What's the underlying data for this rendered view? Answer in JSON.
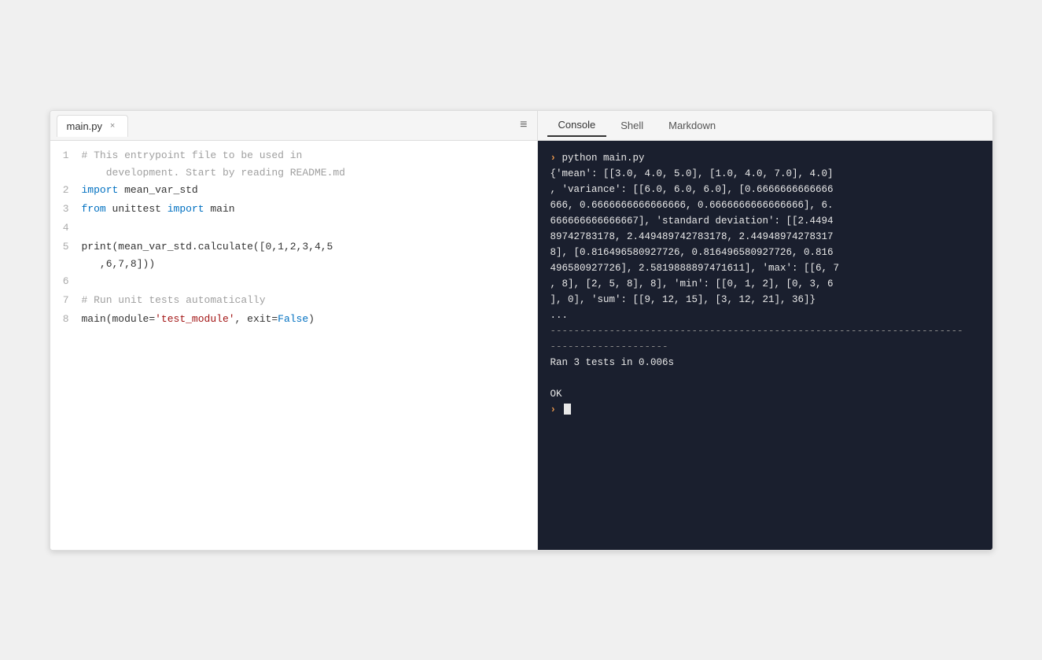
{
  "editor": {
    "tab": {
      "label": "main.py",
      "close": "×"
    },
    "menu_icon": "≡",
    "lines": [
      {
        "number": "1",
        "tokens": [
          {
            "text": "  # This entrypoint file to be used in\n    development. Start by reading README.md",
            "class": "cm"
          }
        ]
      },
      {
        "number": "2",
        "tokens": [
          {
            "text": "import",
            "class": "kw"
          },
          {
            "text": " mean_var_std",
            "class": ""
          }
        ]
      },
      {
        "number": "3",
        "tokens": [
          {
            "text": "from",
            "class": "kw"
          },
          {
            "text": " unittest ",
            "class": ""
          },
          {
            "text": "import",
            "class": "kw"
          },
          {
            "text": " main",
            "class": ""
          }
        ]
      },
      {
        "number": "4",
        "tokens": []
      },
      {
        "number": "5",
        "tokens": [
          {
            "text": "print(mean_var_std.calculate([0,1,2,3,4,5\n,6,7,8]))",
            "class": ""
          }
        ]
      },
      {
        "number": "6",
        "tokens": []
      },
      {
        "number": "7",
        "tokens": [
          {
            "text": "# Run unit tests automatically",
            "class": "cm"
          }
        ]
      },
      {
        "number": "8",
        "tokens": [
          {
            "text": "main(module=",
            "class": ""
          },
          {
            "text": "'test_module'",
            "class": "st"
          },
          {
            "text": ", exit=",
            "class": ""
          },
          {
            "text": "False",
            "class": "kw"
          },
          {
            "text": ")",
            "class": ""
          }
        ]
      }
    ]
  },
  "console": {
    "tabs": [
      {
        "label": "Console",
        "active": true
      },
      {
        "label": "Shell",
        "active": false
      },
      {
        "label": "Markdown",
        "active": false
      }
    ],
    "output": [
      {
        "type": "prompt",
        "text": "> python main.py"
      },
      {
        "type": "output",
        "text": "{'mean': [[3.0, 4.0, 5.0], [1.0, 4.0, 7.0], 4.0]\n, 'variance': [[6.0, 6.0, 6.0], [0.6666666666666\n666, 0.6666666666666666, 0.6666666666666666], 6.\n666666666666667], 'standard deviation': [[2.4494\n89742783178, 2.449489742783178, 2.44948974278317\n8], [0.816496580927726, 0.816496580927726, 0.816\n496580927726], 2.5819888897471611], 'max': [[6, 7\n, 8], [2, 5, 8], 8], 'min': [[0, 1, 2], [0, 3, 6\n], 0], 'sum': [[9, 12, 15], [3, 12, 21], 36]}"
      },
      {
        "type": "output",
        "text": "..."
      },
      {
        "type": "divider",
        "text": "----------------------------------------------------------------------"
      },
      {
        "type": "divider",
        "text": "--------------------"
      },
      {
        "type": "output",
        "text": "Ran 3 tests in 0.006s"
      },
      {
        "type": "blank"
      },
      {
        "type": "ok",
        "text": "OK"
      },
      {
        "type": "prompt_empty",
        "text": "> "
      }
    ]
  }
}
